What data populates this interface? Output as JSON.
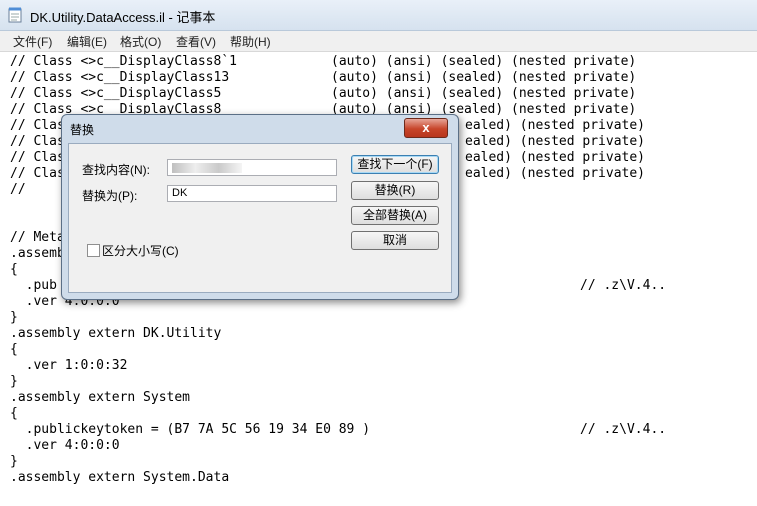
{
  "window": {
    "title": "DK.Utility.DataAccess.il - 记事本"
  },
  "menu": [
    "文件(F)",
    "编辑(E)",
    "格式(O)",
    "查看(V)",
    "帮助(H)"
  ],
  "editor_lines": [
    "// Class <>c__DisplayClass8`1",
    "// Class <>c__DisplayClass13",
    "// Class <>c__DisplayClass5",
    "// Class <>c__DisplayClass8",
    "// Class",
    "// Class",
    "// Class",
    "// Class",
    "//",
    "",
    "",
    "// Meta",
    ".assembly",
    "{",
    "  .pub",
    "  .ver 4:0:0:0",
    "}",
    ".assembly extern DK.Utility",
    "{",
    "  .ver 1:0:0:32",
    "}",
    ".assembly extern System",
    "{",
    "  .publickeytoken = (B7 7A 5C 56 19 34 E0 89 )",
    "  .ver 4:0:0:0",
    "}",
    ".assembly extern System.Data"
  ],
  "attr_column": [
    "(auto) (ansi) (sealed) (nested private)",
    "(auto) (ansi) (sealed) (nested private)",
    "(auto) (ansi) (sealed) (nested private)",
    "(auto) (ansi) (sealed) (nested private)",
    "ealed) (nested private)",
    "ealed) (nested private)",
    "ealed) (nested private)",
    "ealed) (nested private)"
  ],
  "comment_1": "// .z\\V.4..",
  "comment_2": "// .z\\V.4..",
  "dialog": {
    "title": "替换",
    "close_glyph": "x",
    "find_label": "查找内容(N):",
    "find_value": "",
    "replace_label": "替换为(P):",
    "replace_value": "DK",
    "match_case_label": "区分大小写(C)",
    "find_next_button": "查找下一个(F)",
    "replace_button": "替换(R)",
    "replace_all_button": "全部替换(A)",
    "cancel_button": "取消"
  }
}
